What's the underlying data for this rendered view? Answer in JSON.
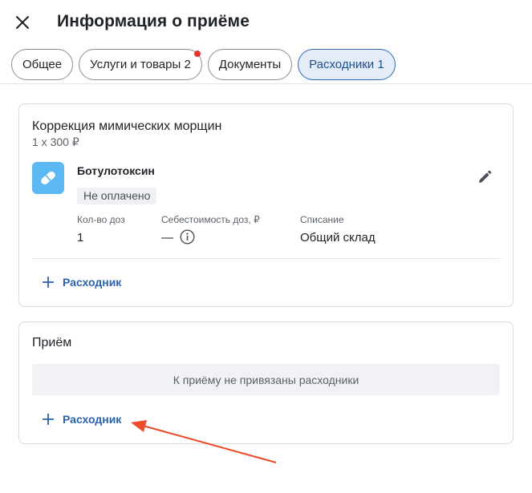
{
  "header": {
    "title": "Информация о приёме",
    "close_icon": "close-icon"
  },
  "tabs": [
    {
      "label": "Общее",
      "active": false,
      "has_dot": false
    },
    {
      "label": "Услуги и товары 2",
      "active": false,
      "has_dot": true
    },
    {
      "label": "Документы",
      "active": false,
      "has_dot": false
    },
    {
      "label": "Расходники 1",
      "active": true,
      "has_dot": false
    }
  ],
  "service": {
    "name": "Коррекция мимических морщин",
    "price": "1 x 300 ₽",
    "item": {
      "icon": "pill-icon",
      "name": "Ботулотоксин",
      "status": "Не оплачено",
      "columns": [
        {
          "label": "Кол-во доз",
          "value": "1"
        },
        {
          "label": "Себестоимость доз, ₽",
          "value": "—"
        },
        {
          "label": "Списание",
          "value": "Общий склад"
        }
      ]
    },
    "add_label": "Расходник"
  },
  "appointment": {
    "title": "Приём",
    "empty_text": "К приёму не привязаны расходники",
    "add_label": "Расходник"
  },
  "colors": {
    "accent": "#2a63ab",
    "active_tab_bg": "#e3ecf7",
    "notification_dot": "#e8332b",
    "item_icon_bg": "#5bb8f2",
    "annotation_arrow": "#ee4b2b"
  }
}
